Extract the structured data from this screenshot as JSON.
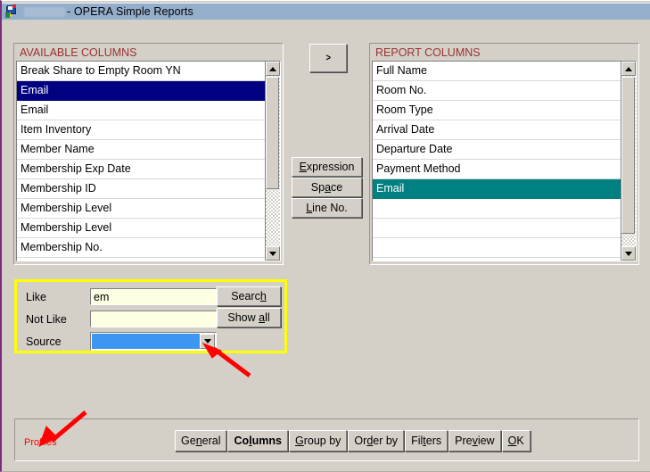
{
  "window": {
    "title": "- OPERA Simple Reports",
    "icon": "opera-app-icon",
    "titlebar_color": "#94aecb"
  },
  "available_columns": {
    "header": "AVAILABLE COLUMNS",
    "header_color": "#993333",
    "selection_color": "#000080",
    "rows": [
      {
        "label": "Break Share to Empty Room YN",
        "selected": false
      },
      {
        "label": "Email",
        "selected": true
      },
      {
        "label": "Email",
        "selected": false
      },
      {
        "label": "Item Inventory",
        "selected": false
      },
      {
        "label": "Member Name",
        "selected": false
      },
      {
        "label": "Membership Exp Date",
        "selected": false
      },
      {
        "label": "Membership ID",
        "selected": false
      },
      {
        "label": "Membership Level",
        "selected": false
      },
      {
        "label": "Membership Level",
        "selected": false
      },
      {
        "label": "Membership No.",
        "selected": false
      }
    ]
  },
  "report_columns": {
    "header": "REPORT COLUMNS",
    "header_color": "#993333",
    "selection_color": "#008080",
    "rows": [
      {
        "label": "Full Name",
        "selected": false
      },
      {
        "label": "Room No.",
        "selected": false
      },
      {
        "label": "Room Type",
        "selected": false
      },
      {
        "label": "Arrival Date",
        "selected": false
      },
      {
        "label": "Departure Date",
        "selected": false
      },
      {
        "label": "Payment Method",
        "selected": false
      },
      {
        "label": "Email",
        "selected": true
      },
      {
        "label": "",
        "selected": false
      },
      {
        "label": "",
        "selected": false
      },
      {
        "label": "",
        "selected": false
      }
    ]
  },
  "middle": {
    "move_button": ">",
    "expression_label": "Expression",
    "expression_mnemonic": "E",
    "space_label": "Space",
    "space_mnemonic": "a",
    "lineno_label": "Line No.",
    "lineno_mnemonic": "L"
  },
  "search": {
    "border_color": "#ffff00",
    "like_label": "Like",
    "like_value": "em",
    "like_placeholder": "",
    "notlike_label": "Not Like",
    "notlike_value": "",
    "notlike_placeholder": "",
    "source_label": "Source",
    "source_value": "",
    "source_highlight_color": "#3d97f0",
    "search_label": "Search",
    "search_mnemonic": "h",
    "showall_label": "Show all",
    "showall_mnemonic": "a"
  },
  "bottom": {
    "profiles_label": "Profiles",
    "profiles_color": "#ff0000",
    "buttons": [
      {
        "label": "General",
        "mnemonic": "n",
        "active": false
      },
      {
        "label": "Columns",
        "mnemonic": "l",
        "active": true
      },
      {
        "label": "Group by",
        "mnemonic": "G",
        "active": false
      },
      {
        "label": "Order by",
        "mnemonic": "d",
        "active": false
      },
      {
        "label": "Filters",
        "mnemonic": "t",
        "active": false
      },
      {
        "label": "Preview",
        "mnemonic": "v",
        "active": false
      },
      {
        "label": "OK",
        "mnemonic": "O",
        "active": false
      }
    ]
  },
  "annotations": {
    "arrow_color": "#ff0000",
    "arrows": [
      {
        "name": "arrow-pointing-to-source-dropdown"
      },
      {
        "name": "arrow-pointing-to-profiles-label"
      }
    ]
  }
}
